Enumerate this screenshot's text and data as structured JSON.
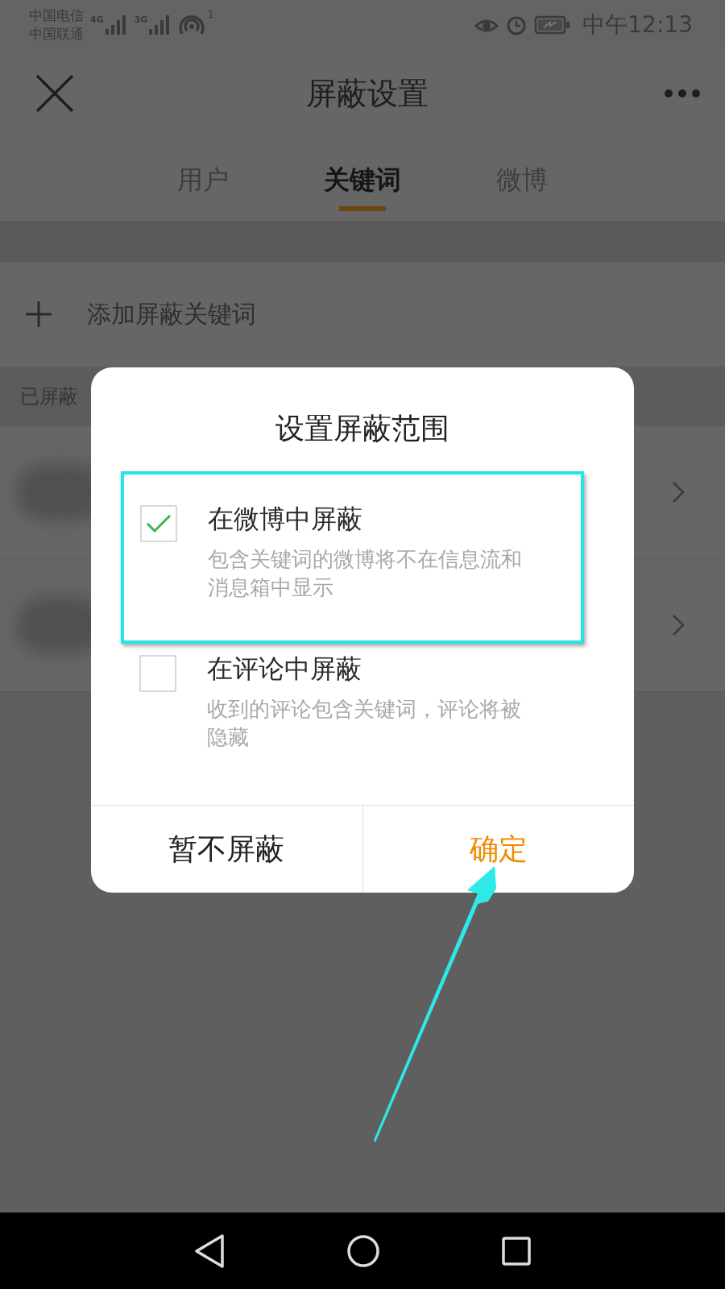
{
  "status_bar": {
    "carriers": [
      "中国电信",
      "中国联通"
    ],
    "networks": [
      "4G",
      "3G"
    ],
    "hotspot_count": "1",
    "time": "中午12:13"
  },
  "header": {
    "title": "屏蔽设置"
  },
  "tabs": [
    {
      "label": "用户",
      "selected": false
    },
    {
      "label": "关键词",
      "selected": true
    },
    {
      "label": "微博",
      "selected": false
    }
  ],
  "add_keyword": {
    "label": "添加屏蔽关键词"
  },
  "section_label": "已屏蔽",
  "blocked_rows": [
    {
      "kind": "blurred"
    },
    {
      "kind": "blurred"
    }
  ],
  "dialog": {
    "title": "设置屏蔽范围",
    "options": [
      {
        "label": "在微博中屏蔽",
        "description": "包含关键词的微博将不在信息流和消息箱中显示",
        "checked": true,
        "highlighted": true
      },
      {
        "label": "在评论中屏蔽",
        "description": "收到的评论包含关键词，评论将被隐藏",
        "checked": false,
        "highlighted": false
      }
    ],
    "buttons": [
      {
        "label": "暂不屏蔽",
        "kind": "secondary"
      },
      {
        "label": "确定",
        "kind": "primary"
      }
    ]
  }
}
